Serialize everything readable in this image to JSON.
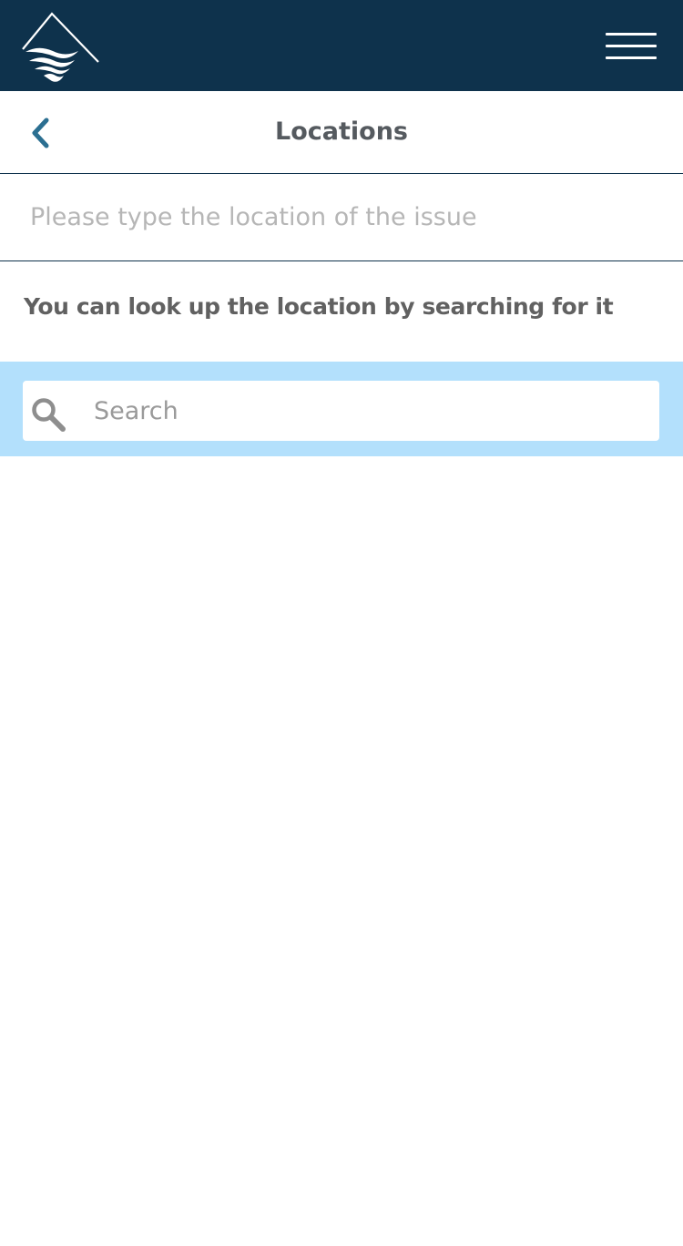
{
  "header": {
    "logo_icon": "mountain-waves-logo",
    "menu_icon": "hamburger-menu-icon",
    "background_color": "#0e324c"
  },
  "title_bar": {
    "back_icon": "chevron-left-icon",
    "back_color": "#2b6f91",
    "title": "Locations"
  },
  "location_field": {
    "value": "",
    "placeholder": "Please type the location of the issue"
  },
  "helper": {
    "text": "You can look up the location by searching for it"
  },
  "search": {
    "icon": "search-icon",
    "value": "",
    "placeholder": "Search",
    "band_color": "#b3e0fc"
  }
}
